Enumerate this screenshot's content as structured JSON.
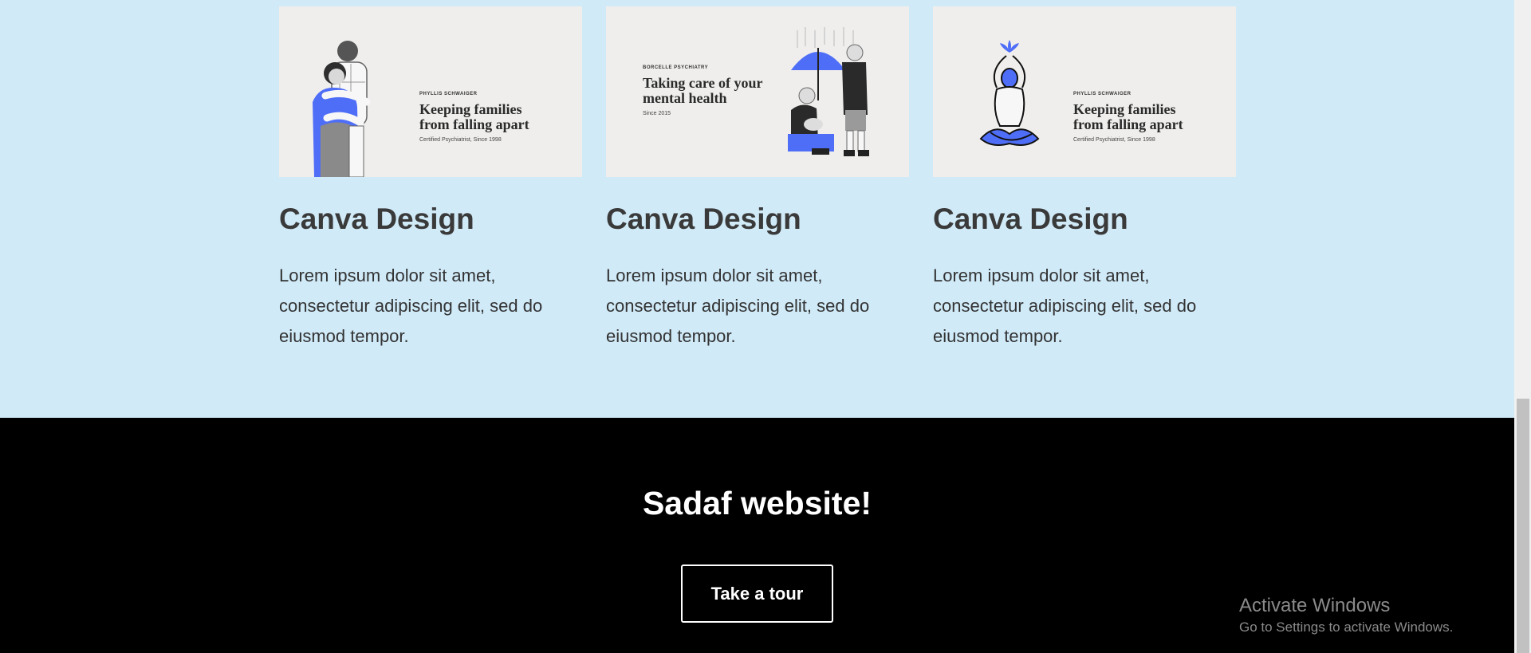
{
  "portfolio": {
    "cards": [
      {
        "thumbnail": {
          "eyebrow": "PHYLLIS SCHWAIGER",
          "headline_line1": "Keeping families",
          "headline_line2": "from falling apart",
          "subtitle": "Certified Psychiatrist, Since 1998"
        },
        "title": "Canva Design",
        "text": "Lorem ipsum dolor sit amet, consectetur adipiscing elit, sed do eiusmod tempor."
      },
      {
        "thumbnail": {
          "eyebrow": "BORCELLE PSYCHIATRY",
          "headline_line1": "Taking care of your",
          "headline_line2": "mental health",
          "subtitle": "Since 2015"
        },
        "title": "Canva Design",
        "text": "Lorem ipsum dolor sit amet, consectetur adipiscing elit, sed do eiusmod tempor."
      },
      {
        "thumbnail": {
          "eyebrow": "PHYLLIS SCHWAIGER",
          "headline_line1": "Keeping families",
          "headline_line2": "from falling apart",
          "subtitle": "Certified Psychiatrist, Since 1998"
        },
        "title": "Canva Design",
        "text": "Lorem ipsum dolor sit amet, consectetur adipiscing elit, sed do eiusmod tempor."
      }
    ]
  },
  "footer": {
    "title": "Sadaf website!",
    "button_label": "Take a tour"
  },
  "watermark": {
    "title": "Activate Windows",
    "subtitle": "Go to Settings to activate Windows."
  },
  "colors": {
    "section_bg": "#d0eaf8",
    "footer_bg": "#000000",
    "accent_blue": "#4f6ef7",
    "thumb_bg": "#efeeec"
  }
}
